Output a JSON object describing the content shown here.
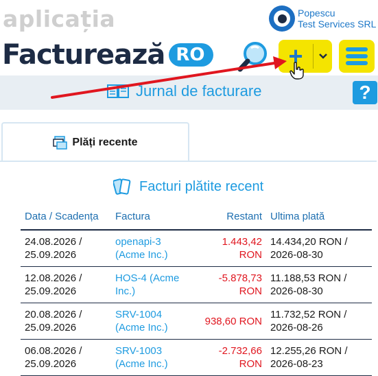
{
  "header": {
    "app_label": "aplicația",
    "brand_name": "Facturează",
    "brand_tld": "RO",
    "user_name": "Popescu",
    "company": "Test Services SRL"
  },
  "toolbar": {
    "search_icon": "search-icon",
    "add_label": "+",
    "add_caret": "⌄",
    "menu_icon": "hamburger-icon"
  },
  "journal": {
    "title": "Jurnal de facturare",
    "help_label": "?"
  },
  "tabs": [
    {
      "label": "Plăți recente",
      "active": true
    }
  ],
  "panel": {
    "title": "Facturi plătite recent",
    "columns": [
      "Data / Scadența",
      "Factura",
      "Restant",
      "Ultima plată"
    ],
    "rows": [
      {
        "dates": "24.08.2026 / 25.09.2026",
        "invoice": "openapi-3 (Acme Inc.)",
        "due": "1.443,42 RON",
        "last_payment": "14.434,20 RON / 2026-08-30"
      },
      {
        "dates": "12.08.2026 / 25.09.2026",
        "invoice": "HOS-4 (Acme Inc.)",
        "due": "-5.878,73 RON",
        "last_payment": "11.188,53 RON / 2026-08-30"
      },
      {
        "dates": "20.08.2026 / 25.09.2026",
        "invoice": "SRV-1004 (Acme Inc.)",
        "due": "938,60 RON",
        "last_payment": "11.732,52 RON / 2026-08-26"
      },
      {
        "dates": "06.08.2026 / 25.09.2026",
        "invoice": "SRV-1003 (Acme Inc.)",
        "due": "-2.732,66 RON",
        "last_payment": "12.255,26 RON / 2026-08-23"
      }
    ]
  },
  "colors": {
    "accent": "#1e9be0",
    "brand_dark": "#1d2b44",
    "button_yellow": "#f4e400",
    "negative": "#e0161f",
    "arrow": "#e0161f"
  }
}
